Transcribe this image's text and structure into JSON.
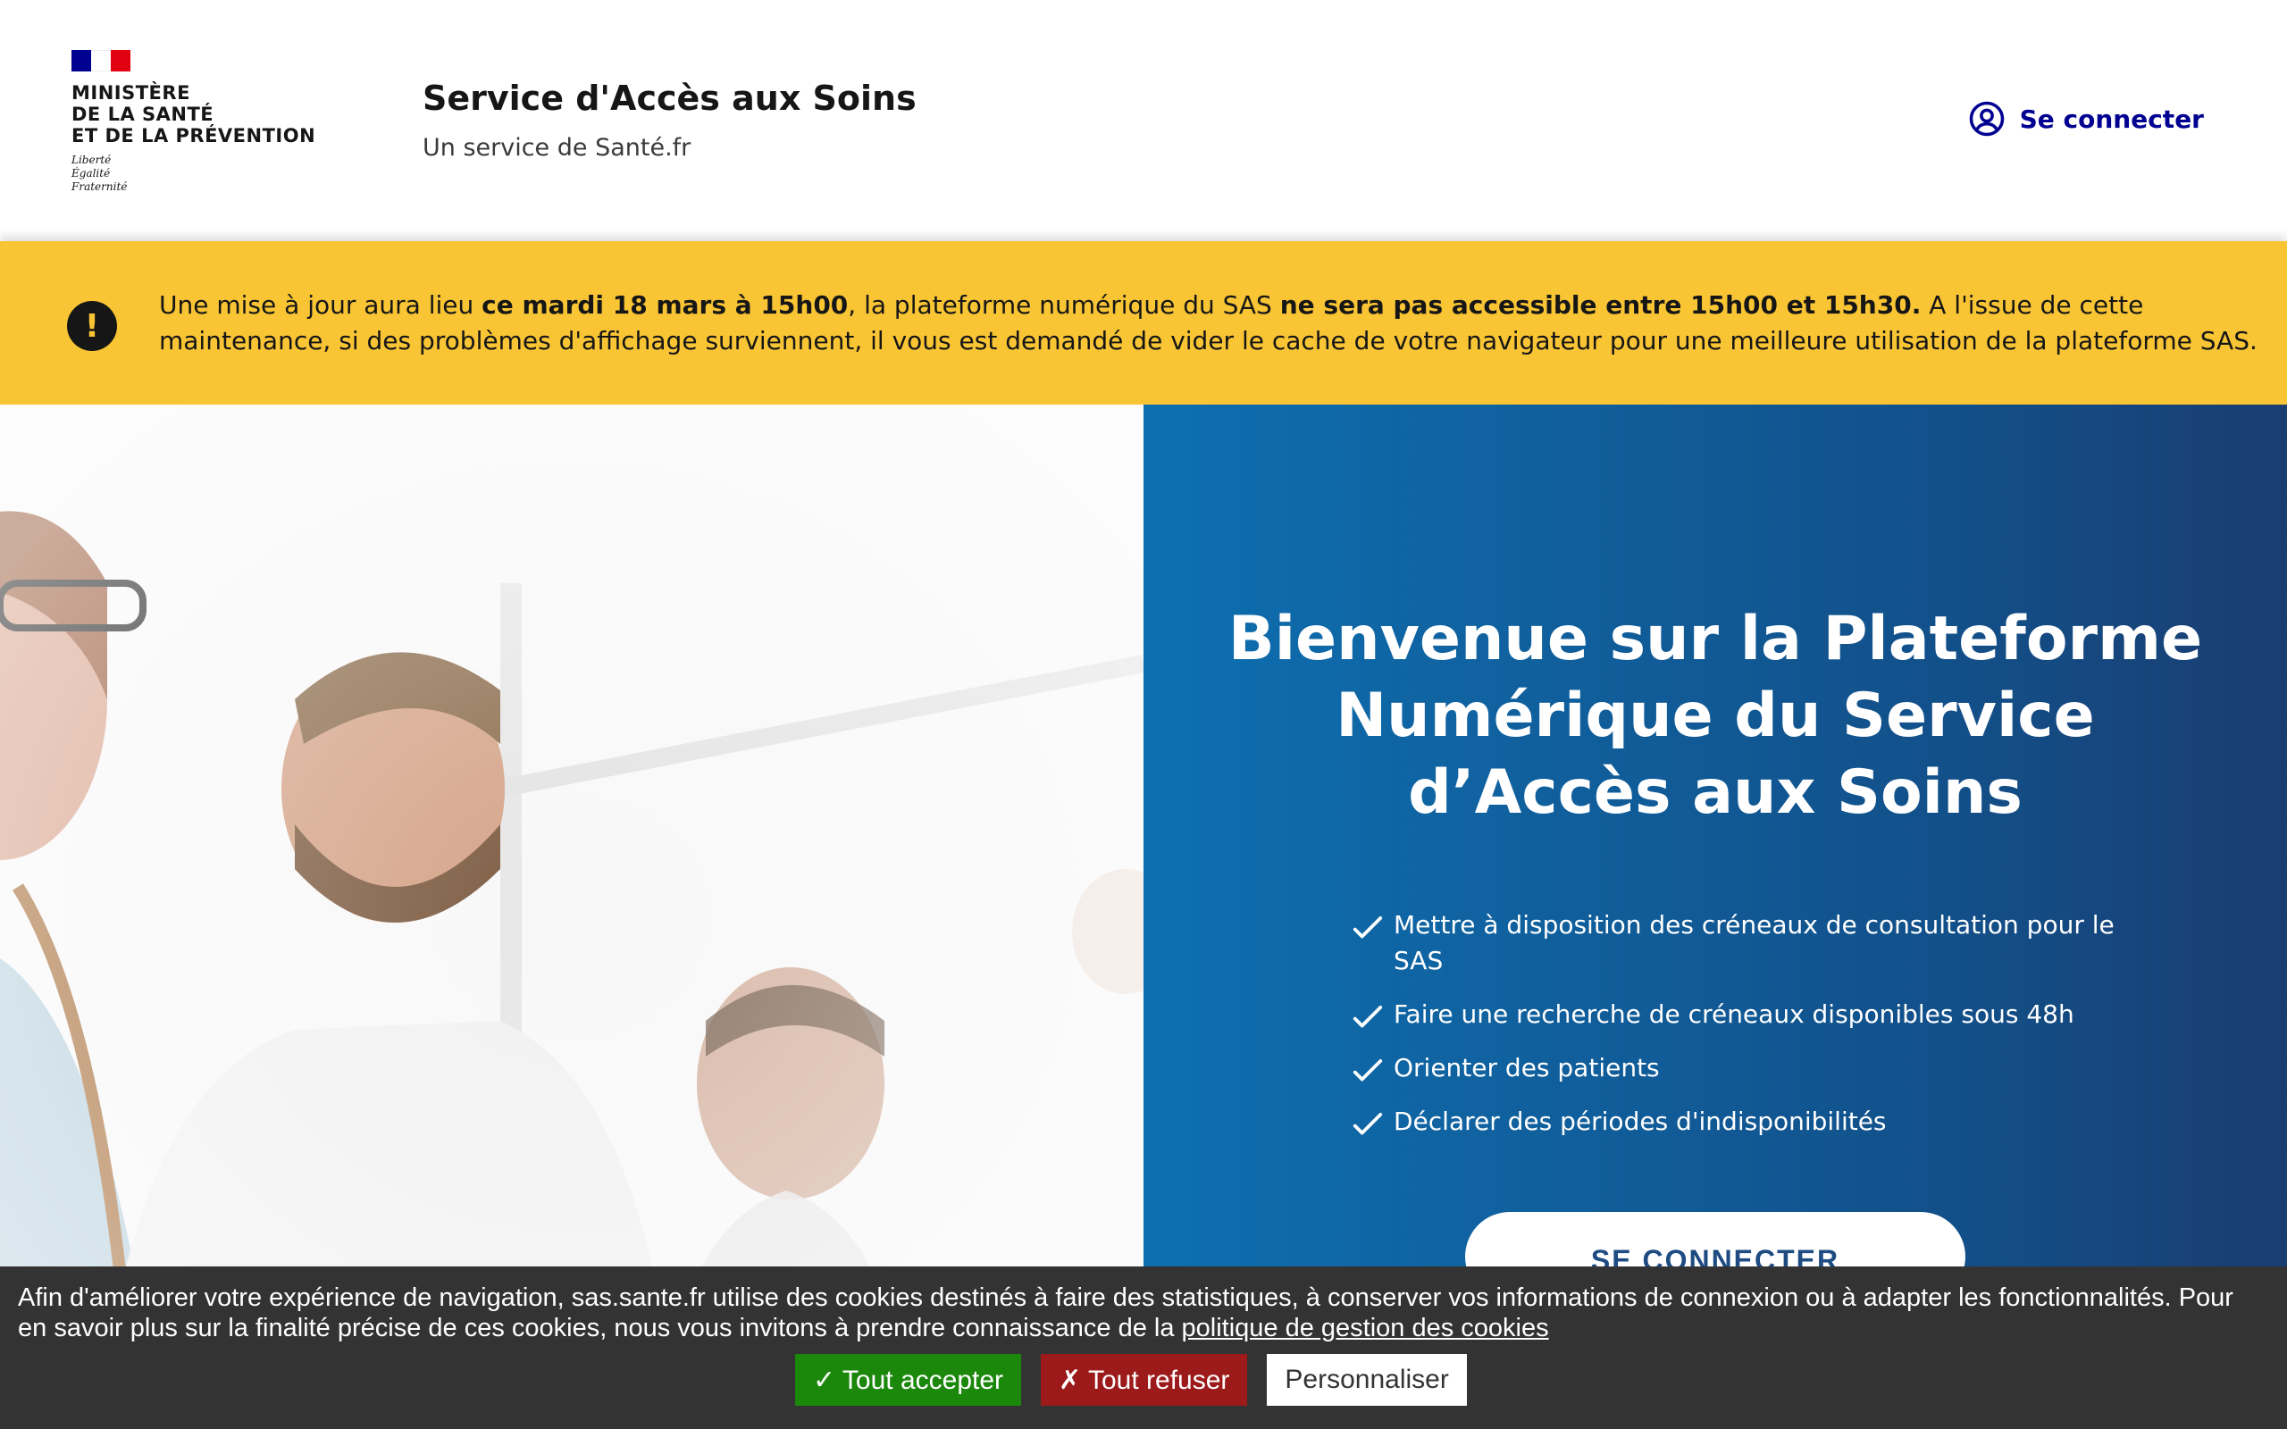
{
  "header": {
    "logo": {
      "ministry_lines": [
        "MINISTÈRE",
        "DE LA SANTÉ",
        "ET DE LA PRÉVENTION"
      ],
      "devise_lines": [
        "Liberté",
        "Égalité",
        "Fraternité"
      ],
      "flag_colors": [
        "#000091",
        "#ffffff",
        "#e1000f"
      ]
    },
    "title": "Service d'Accès aux Soins",
    "subtitle": "Un service de Santé.fr",
    "login_label": "Se connecter",
    "login_icon": "user-circle-icon",
    "accent": "#000091"
  },
  "alert": {
    "icon": "exclamation-icon",
    "bg_color": "#f9c534",
    "parts": [
      {
        "text": "Une mise à jour aura lieu ",
        "bold": false
      },
      {
        "text": "ce mardi 18 mars à 15h00",
        "bold": true
      },
      {
        "text": ", la plateforme numérique du SAS ",
        "bold": false
      },
      {
        "text": "ne sera pas accessible entre 15h00 et 15h30.",
        "bold": true
      },
      {
        "text": " A l'issue de cette maintenance, si des problèmes d'affichage surviennent, il vous est demandé de vider le cache de votre navigateur pour une meilleure utilisation de la plateforme SAS.",
        "bold": false
      }
    ]
  },
  "hero": {
    "title_lines": [
      "Bienvenue sur la Plateforme",
      "Numérique du Service",
      "d’Accès aux Soins"
    ],
    "features": [
      "Mettre à disposition des créneaux de consultation pour le SAS",
      "Faire une recherche de créneaux disponibles sous 48h",
      "Orienter des patients",
      "Déclarer des périodes d'indisponibilités"
    ],
    "feature_icon": "check-icon",
    "cta_label": "SE CONNECTER",
    "panel_colors": [
      "#0e6fb0",
      "#1a3d70"
    ]
  },
  "cookie": {
    "text": "Afin d'améliorer votre expérience de navigation, sas.sante.fr utilise des cookies destinés à faire des statistiques, à conserver vos informations de connexion ou à adapter les fonctionnalités. Pour en savoir plus sur la finalité précise de ces cookies, nous vous invitons à prendre connaissance de la ",
    "link_label": "politique de gestion des cookies",
    "accept_label": "✓ Tout accepter",
    "deny_label": "✗ Tout refuser",
    "custom_label": "Personnaliser",
    "accept_color": "#1b870b",
    "deny_color": "#9c1a1a"
  }
}
